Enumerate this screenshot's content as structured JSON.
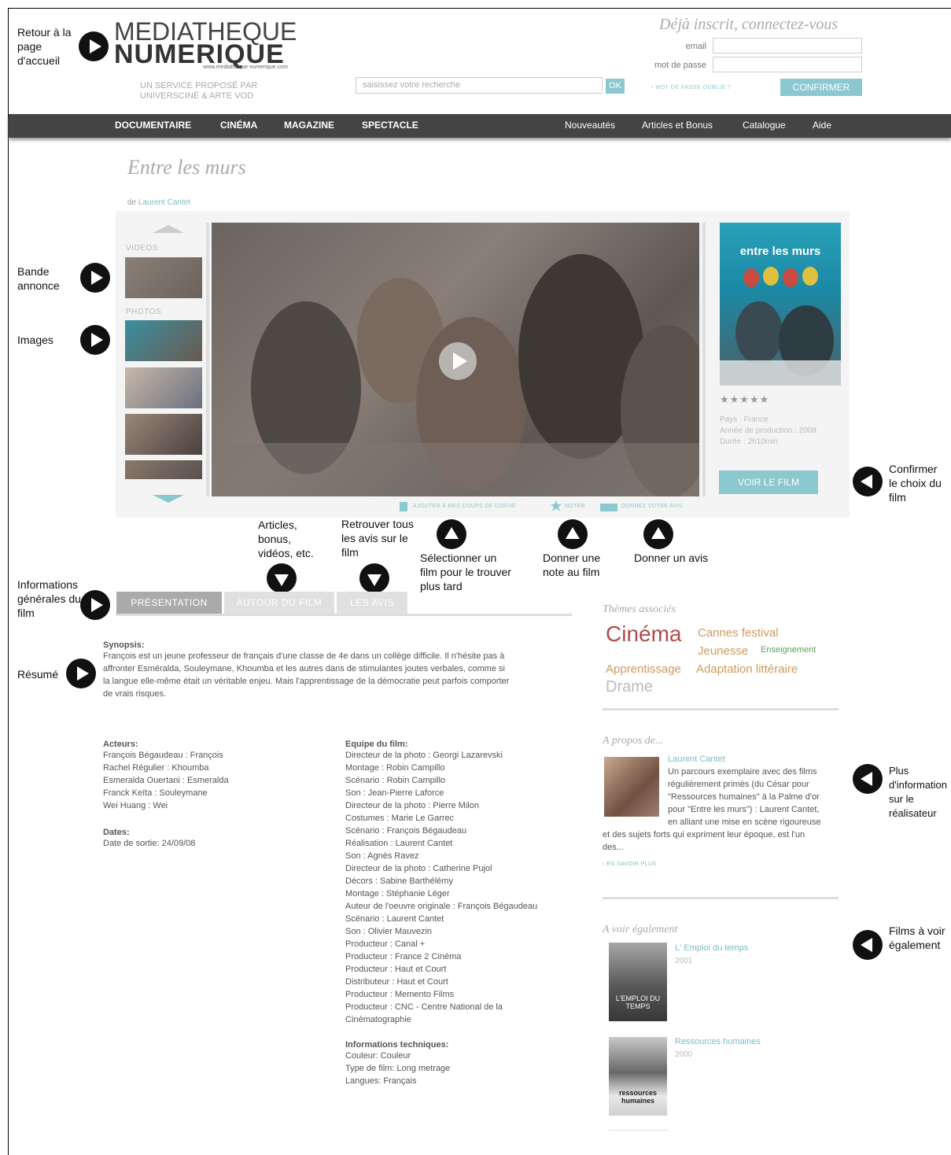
{
  "annotations": {
    "home": "Retour à la page d'accueil",
    "trailer": "Bande annonce",
    "images": "Images",
    "articles": "Articles, bonus, vidéos, etc.",
    "reviews_find": "Retrouver tous les avis sur le film",
    "select_later": "Sélectionner un film pour le trouver plus tard",
    "rate": "Donner une note au film",
    "review": "Donner un avis",
    "general_info": "Informations générales du film",
    "summary": "Résumé",
    "confirm_choice": "Confirmer le choix du film",
    "more_director": "Plus d'information sur le réalisateur",
    "films_also": "Films à voir également"
  },
  "logo": {
    "line1": "MEDIATHEQUE",
    "line2": "NUMERIQUE",
    "url": "www.mediatheque-numerique.com",
    "tagline1": "UN SERVICE PROPOSÉ PAR",
    "tagline2": "UNIVERSCINÉ & ARTE VOD"
  },
  "search": {
    "placeholder": "saisissez votre recherche",
    "button": "OK"
  },
  "login": {
    "title": "Déjà inscrit, connectez-vous",
    "email_label": "email",
    "password_label": "mot de passe",
    "forgot": "› MOT DE PASSE OUBLIÉ ?",
    "confirm": "CONFIRMER"
  },
  "nav": {
    "left": [
      "DOCUMENTAIRE",
      "CINÉMA",
      "MAGAZINE",
      "SPECTACLE"
    ],
    "right": [
      "Nouveautés",
      "Articles et Bonus",
      "Catalogue",
      "Aide"
    ]
  },
  "film": {
    "title": "Entre les murs",
    "by": "de",
    "director": "Laurent Cantet",
    "videos_label": "VIDEOS",
    "photos_label": "PHOTOS",
    "poster_title": "entre les murs",
    "rating_stars": "★★★★★",
    "country": "Pays : France",
    "year": "Année de production : 2008",
    "duration": "Durée : 2h10min",
    "watch": "VOIR LE FILM",
    "actions": [
      "AJOUTER À MES COUPS DE COEUR",
      "NOTER",
      "DONNEZ VOTRE AVIS"
    ]
  },
  "tabs": [
    "PRÉSENTATION",
    "AUTOUR DU FILM",
    "LES AVIS"
  ],
  "synopsis": {
    "heading": "Synopsis:",
    "lines": [
      "François est un jeune professeur de français d'une classe de 4e dans un collège difficile. Il n'hésite pas à",
      "affronter Esméralda, Souleymane, Khoumba et les autres dans de stimulantes joutes verbales, comme si",
      "la langue elle-même était un véritable enjeu. Mais l'apprentissage de la démocratie peut parfois comporter",
      "de vrais risques."
    ]
  },
  "actors": {
    "heading": "Acteurs:",
    "lines": [
      "François Bégaudeau : François",
      "Rachel Régulier : Khoumba",
      "Esmeralda Ouertani : Esmeralda",
      "Franck Keïta : Souleymane",
      "Wei Huang : Wei"
    ]
  },
  "dates": {
    "heading": "Dates:",
    "lines": [
      "Date de sortie: 24/09/08"
    ]
  },
  "crew": {
    "heading": "Equipe du film:",
    "lines": [
      "Directeur de la photo : Georgi Lazarevski",
      "Montage : Robin Campillo",
      "Scénario : Robin Campillo",
      "Son : Jean-Pierre Laforce",
      "Directeur de la photo : Pierre Milon",
      "Costumes : Marie Le Garrec",
      "Scénario : François Bégaudeau",
      "Réalisation : Laurent Cantet",
      "Son : Agnès Ravez",
      "Directeur de la photo : Catherine Pujol",
      "Décors : Sabine Barthélémy",
      "Montage : Stéphanie Léger",
      "Auteur de l'oeuvre originale : François Bégaudeau",
      "Scénario : Laurent Cantet",
      "Son : Olivier Mauvezin",
      "Producteur : Canal +",
      "Producteur : France 2 Cinéma",
      "Producteur : Haut et Court",
      "Distributeur : Haut et Court",
      "Producteur : Memento Films",
      "Producteur : CNC - Centre National de la",
      "Cinématographie"
    ]
  },
  "tech": {
    "heading": "Informations techniques:",
    "lines": [
      "Couleur: Couleur",
      "Type de film: Long metrage",
      "Langues: Français"
    ]
  },
  "themes": {
    "heading": "Thèmes associés",
    "tags": [
      "Cinéma",
      "Cannes festival",
      "Jeunesse",
      "Enseignement",
      "Apprentissage",
      "Adaptation littéraire",
      "Drame"
    ]
  },
  "about": {
    "heading": "A propos de...",
    "name": "Laurent Cantet",
    "lines": [
      "Un parcours exemplaire avec des films",
      "régulièrement primés (du César pour",
      "\"Ressources humaines\" à la Palme d'or",
      "pour \"Entre les murs\") : Laurent Cantet,",
      "en alliant une mise en scène rigoureuse"
    ],
    "lines_full": [
      "et des sujets forts qui expriment leur époque, est l'un",
      "des..."
    ],
    "more": "› EN SAVOIR PLUS"
  },
  "also": {
    "heading": "A voir également",
    "films": [
      {
        "title": "L' Emploi du temps",
        "year": "2001",
        "poster_text": "L'EMPLOI DU TEMPS"
      },
      {
        "title": "Ressources humaines",
        "year": "2000",
        "poster_text": "ressources humaines"
      }
    ]
  },
  "colors": {
    "accent": "#8cc8cf",
    "nav_bg": "#444444",
    "cinema_tag": "#b04a4a",
    "tag_orange": "#d09a5a",
    "tag_green": "#5aa05a"
  }
}
